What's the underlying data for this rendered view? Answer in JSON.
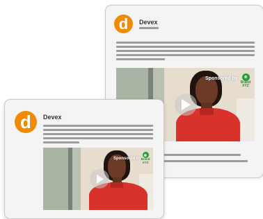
{
  "cards": [
    {
      "id": "back",
      "brand": "Devex",
      "logo_letter": "d",
      "sponsored_label": "Sponsored by",
      "sponsor_brand": "Brand XYZ"
    },
    {
      "id": "front",
      "brand": "Devex",
      "logo_letter": "d",
      "sponsored_label": "Sponsored by",
      "sponsor_brand": "Brand XYZ"
    }
  ],
  "colors": {
    "logo_orange": "#f08a00",
    "shirt_red": "#d8322a",
    "brand_green": "#2a9d3a",
    "text_line_gray": "#9c9c9c"
  },
  "icons": [
    "devex-logo-icon",
    "play-icon",
    "brand-xyz-logo-icon"
  ]
}
